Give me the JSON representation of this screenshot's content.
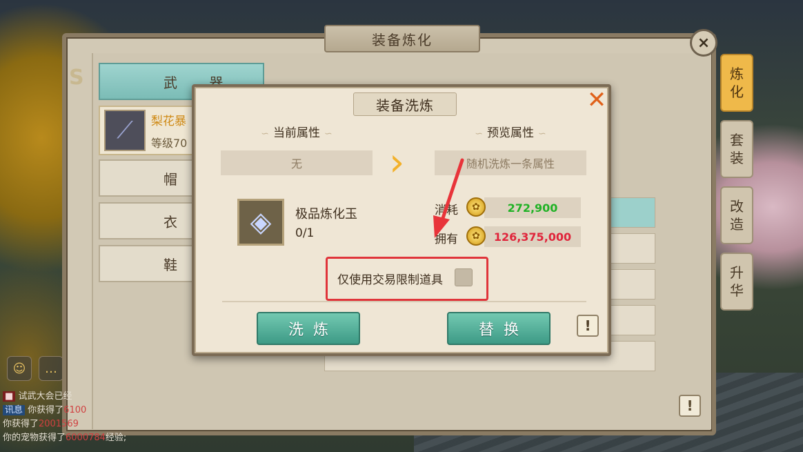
{
  "main_panel": {
    "title": "装备炼化",
    "close_label": "×",
    "info_label": "!"
  },
  "categories": [
    {
      "label": "武 器",
      "active": true
    },
    {
      "label": "帽 子"
    },
    {
      "label": "衣 服"
    },
    {
      "label": "鞋 子"
    }
  ],
  "selected_item": {
    "name": "梨花暴",
    "level": "等级70",
    "icon": "spear-icon"
  },
  "side_tabs": [
    {
      "line1": "炼",
      "line2": "化",
      "active": true
    },
    {
      "line1": "套",
      "line2": "装"
    },
    {
      "line1": "改",
      "line2": "造"
    },
    {
      "line1": "升",
      "line2": "华"
    }
  ],
  "dialog": {
    "title": "装备洗炼",
    "close_label": "✕",
    "current_header": "当前属性",
    "current_value": "无",
    "preview_header": "预览属性",
    "preview_value": "随机洗炼一条属性",
    "material_name": "极品炼化玉",
    "material_count": "0/1",
    "cost_label": "消耗",
    "cost_value": "272,900",
    "own_label": "拥有",
    "own_value": "126,375,000",
    "restrict_label": "仅使用交易限制道具",
    "restrict_checked": false,
    "refine_button": "洗炼",
    "replace_button": "替换",
    "info_label": "!"
  },
  "chat": {
    "lines": [
      {
        "tag": "",
        "text": "试武大会已经"
      },
      {
        "tag": "讯息",
        "text": "你获得了",
        "value": "6100"
      },
      {
        "tag": "",
        "text": "你获得了",
        "value": "2001569"
      },
      {
        "tag": "",
        "text": "你的宠物获得了",
        "value": "6000784",
        "suffix": "经验;"
      }
    ]
  },
  "colors": {
    "accent_teal": "#5fb9a3",
    "active_tab": "#efb94a",
    "close_orange": "#e0611a",
    "cost_green": "#21b226",
    "own_red": "#e0253b",
    "highlight_red": "#e0343a"
  }
}
